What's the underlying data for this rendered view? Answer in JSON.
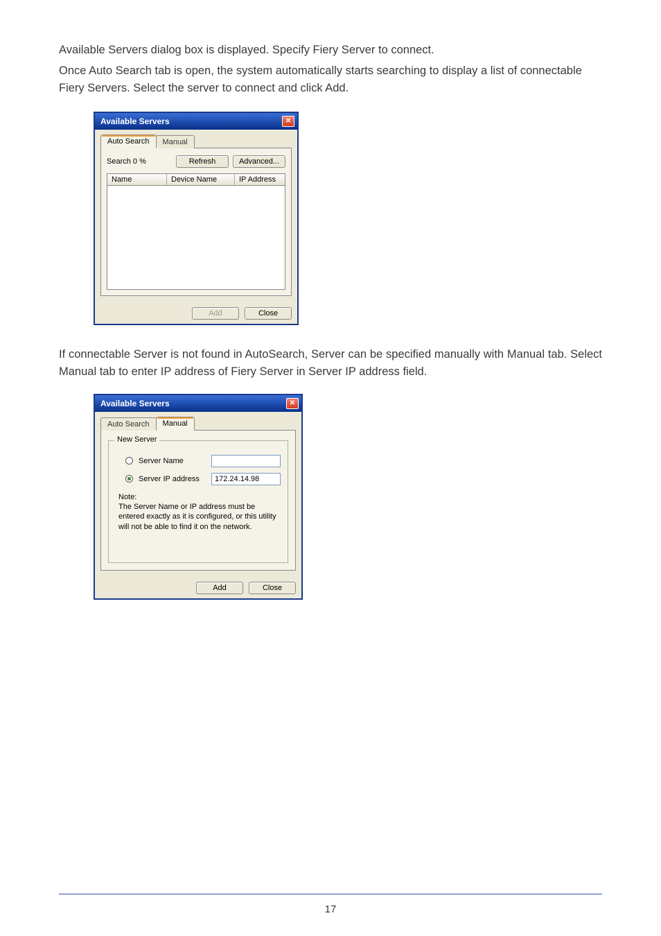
{
  "paragraphs": {
    "p1": "Available Servers dialog box is displayed. Specify Fiery Server to connect.",
    "p2": "Once Auto Search tab is open, the system automatically starts searching to display a list of connectable Fiery Servers. Select the server to connect and click Add.",
    "p3": "If connectable Server is not found in AutoSearch, Server can be specified manually with Manual tab. Select Manual tab to enter IP address of Fiery Server in Server IP address field."
  },
  "dialog1": {
    "title": "Available Servers",
    "tab_auto": "Auto Search",
    "tab_manual": "Manual",
    "search_status": "Search 0 %",
    "btn_refresh": "Refresh",
    "btn_advanced": "Advanced...",
    "col_name": "Name",
    "col_device": "Device Name",
    "col_ip": "IP Address",
    "btn_add": "Add",
    "btn_close": "Close"
  },
  "dialog2": {
    "title": "Available Servers",
    "tab_auto": "Auto Search",
    "tab_manual": "Manual",
    "group_legend": "New Server",
    "radio_server_name": "Server Name",
    "radio_server_ip": "Server IP address",
    "ip_value": "172.24.14.98",
    "note_label": "Note:",
    "note_text": "The Server Name or IP address must be entered exactly as it is configured, or this utility will not be able to find it on the network.",
    "btn_add": "Add",
    "btn_close": "Close"
  },
  "page_number": "17"
}
